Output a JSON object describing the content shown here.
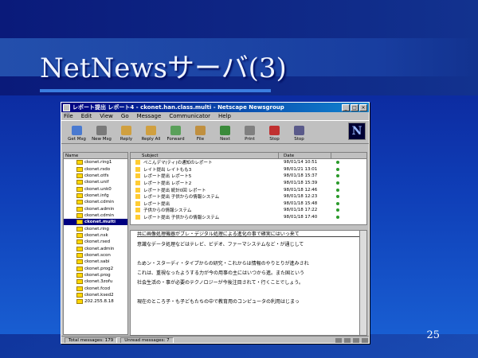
{
  "slide": {
    "title": "NetNewsサーバ(3)",
    "page_number": "25"
  },
  "window": {
    "title": "レポート提出 レポート4 - ckonet.han.class.multi - Netscape Newsgroup",
    "menu": [
      "File",
      "Edit",
      "View",
      "Go",
      "Message",
      "Communicator",
      "Help"
    ],
    "toolbar": [
      {
        "label": "Get Msg",
        "icon": "get-msg-icon",
        "color": "#4a7ad0"
      },
      {
        "label": "New Msg",
        "icon": "new-msg-icon",
        "color": "#7a7a7a"
      },
      {
        "label": "Reply",
        "icon": "reply-icon",
        "color": "#d0a040"
      },
      {
        "label": "Reply All",
        "icon": "reply-all-icon",
        "color": "#d0a040"
      },
      {
        "label": "Forward",
        "icon": "forward-icon",
        "color": "#5aa05a"
      },
      {
        "label": "File",
        "icon": "file-icon",
        "color": "#c09040"
      },
      {
        "label": "Next",
        "icon": "next-icon",
        "color": "#3a8a3a"
      },
      {
        "label": "Print",
        "icon": "print-icon",
        "color": "#808080"
      },
      {
        "label": "Stop",
        "icon": "stop-icon",
        "color": "#c03030"
      },
      {
        "label": "Stop",
        "icon": "stop2-icon",
        "color": "#5a5a8a"
      }
    ],
    "folder_pane": {
      "header": "Name",
      "folders": [
        "ckonet.ring1",
        "ckonet.rsdo",
        "ckonet.otfs",
        "ckonet.unif",
        "ckonet.unk0",
        "ckonet.infg",
        "ckonet.cdmin",
        "ckonet.admin",
        "ckonet.cdmin",
        "ckonet.multi",
        "ckonet.ring",
        "ckonet.nsk",
        "ckonet.rsed",
        "ckonet.admin",
        "ckonet.scon",
        "ckonet.sabi",
        "ckonet.prog2",
        "ckonet.prog",
        "ckonet.3zofu",
        "ckonet.fcod",
        "ckonet.ksed2",
        "202.255.8.18"
      ],
      "selected_index": 9
    },
    "message_list": {
      "columns": {
        "subject": "Subject",
        "date": "Date"
      },
      "rows": [
        {
          "subject": "ぺこんデマ(ティ)の通知のレポート",
          "date": "98/01/14 10:51"
        },
        {
          "subject": "レイト提出 レイトもも3",
          "date": "98/01/21 13:01"
        },
        {
          "subject": "レポート提出 レポート5",
          "date": "98/01/18 15:37"
        },
        {
          "subject": "レポート提出 レポート2",
          "date": "98/01/18 15:39"
        },
        {
          "subject": "レポート提出 統計0回 レポート",
          "date": "98/01/18 12:46"
        },
        {
          "subject": "レポート提出 子供からの情報システム",
          "date": "98/01/18 12:23"
        },
        {
          "subject": "レポート提出",
          "date": "98/01/18 15:48"
        },
        {
          "subject": "子供からの情報システム",
          "date": "98/01/18 17:22"
        },
        {
          "subject": "レポート提出 子供からの情報システム",
          "date": "98/01/18 17:40"
        }
      ]
    },
    "preview": {
      "lines": [
        "共に画像処理機器がブレ・デジタル処理による進化の事で確実にはいっ来て",
        "意識なデータ処理などはテレビ、ビデオ、ファーマシステムなど・が通じして",
        "",
        "ためン・スターディ・タイプからの研究・これからは情報のやりとりが進みされ",
        "これは、重視なったようする力が今の用事の主にはいつから進。また国という",
        "社会生活の・事が必要のテクノロジーが今後注目されて・行くことでしょう。",
        "",
        "現在のところ子・も子どもたちの中で教育用のコンピュータの利用はじまっ"
      ]
    },
    "status": {
      "total": "Total messages: 179",
      "unread": "Unread messages: 7"
    }
  }
}
